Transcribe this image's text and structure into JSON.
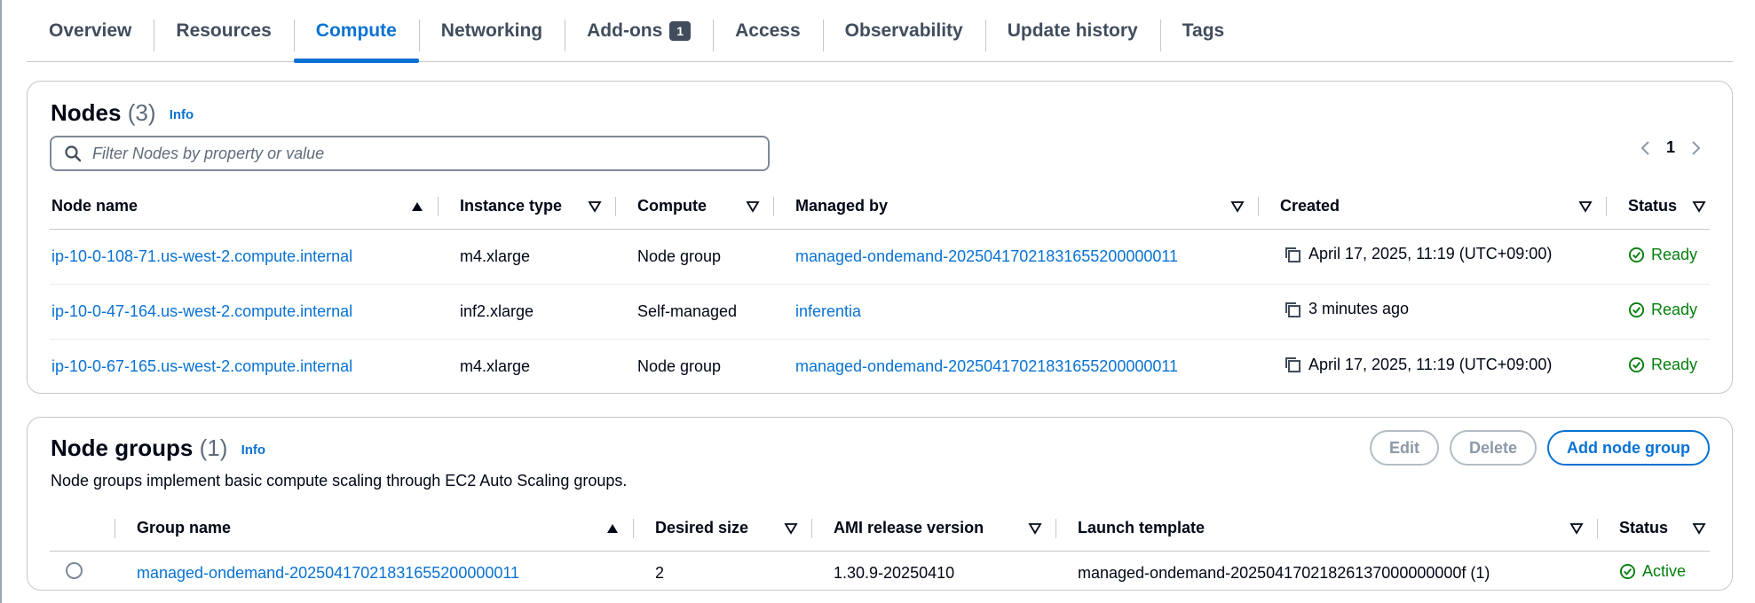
{
  "tabs": [
    {
      "label": "Overview"
    },
    {
      "label": "Resources"
    },
    {
      "label": "Compute",
      "active": true
    },
    {
      "label": "Networking"
    },
    {
      "label": "Add-ons",
      "badge": "1"
    },
    {
      "label": "Access"
    },
    {
      "label": "Observability"
    },
    {
      "label": "Update history"
    },
    {
      "label": "Tags"
    }
  ],
  "nodes": {
    "title": "Nodes",
    "count": "(3)",
    "info": "Info",
    "filter_placeholder": "Filter Nodes by property or value",
    "page": "1",
    "columns": [
      "Node name",
      "Instance type",
      "Compute",
      "Managed by",
      "Created",
      "Status"
    ],
    "rows": [
      {
        "name": "ip-10-0-108-71.us-west-2.compute.internal",
        "instance": "m4.xlarge",
        "compute": "Node group",
        "managed_by": "managed-ondemand-20250417021831655200000011",
        "created": "April 17, 2025, 11:19 (UTC+09:00)",
        "status": "Ready"
      },
      {
        "name": "ip-10-0-47-164.us-west-2.compute.internal",
        "instance": "inf2.xlarge",
        "compute": "Self-managed",
        "managed_by": "inferentia",
        "created": "3 minutes ago",
        "status": "Ready"
      },
      {
        "name": "ip-10-0-67-165.us-west-2.compute.internal",
        "instance": "m4.xlarge",
        "compute": "Node group",
        "managed_by": "managed-ondemand-20250417021831655200000011",
        "created": "April 17, 2025, 11:19 (UTC+09:00)",
        "status": "Ready"
      }
    ]
  },
  "node_groups": {
    "title": "Node groups",
    "count": "(1)",
    "info": "Info",
    "description": "Node groups implement basic compute scaling through EC2 Auto Scaling groups.",
    "buttons": {
      "edit": "Edit",
      "delete": "Delete",
      "add": "Add node group"
    },
    "columns": [
      "Group name",
      "Desired size",
      "AMI release version",
      "Launch template",
      "Status"
    ],
    "rows": [
      {
        "name": "managed-ondemand-20250417021831655200000011",
        "desired": "2",
        "ami": "1.30.9-20250410",
        "template": "managed-ondemand-20250417021826137000000000f (1)",
        "status": "Active"
      }
    ]
  },
  "colors": {
    "link": "#0972d3",
    "success": "#037f0c",
    "text": "#000716",
    "border": "#c6c6cd"
  }
}
